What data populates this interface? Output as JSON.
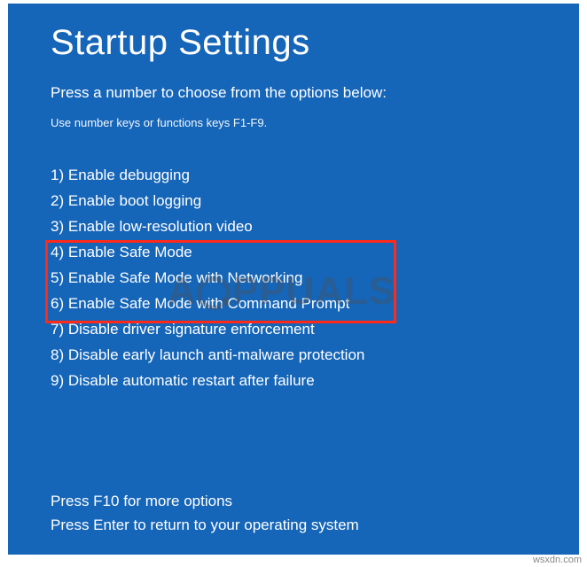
{
  "title": "Startup Settings",
  "subtitle": "Press a number to choose from the options below:",
  "hint": "Use number keys or functions keys F1-F9.",
  "options": [
    {
      "n": 1,
      "label": "Enable debugging"
    },
    {
      "n": 2,
      "label": "Enable boot logging"
    },
    {
      "n": 3,
      "label": "Enable low-resolution video"
    },
    {
      "n": 4,
      "label": "Enable Safe Mode"
    },
    {
      "n": 5,
      "label": "Enable Safe Mode with Networking"
    },
    {
      "n": 6,
      "label": "Enable Safe Mode with Command Prompt"
    },
    {
      "n": 7,
      "label": "Disable driver signature enforcement"
    },
    {
      "n": 8,
      "label": "Disable early launch anti-malware protection"
    },
    {
      "n": 9,
      "label": "Disable automatic restart after failure"
    }
  ],
  "highlighted_range": {
    "start": 4,
    "end": 6
  },
  "footer": {
    "line1": "Press F10 for more options",
    "line2": "Press Enter to return to your operating system"
  },
  "watermark": "PPUALS",
  "attribution": "wsxdn.com",
  "colors": {
    "background": "#1565b8",
    "highlight_border": "#ff2a1a"
  }
}
